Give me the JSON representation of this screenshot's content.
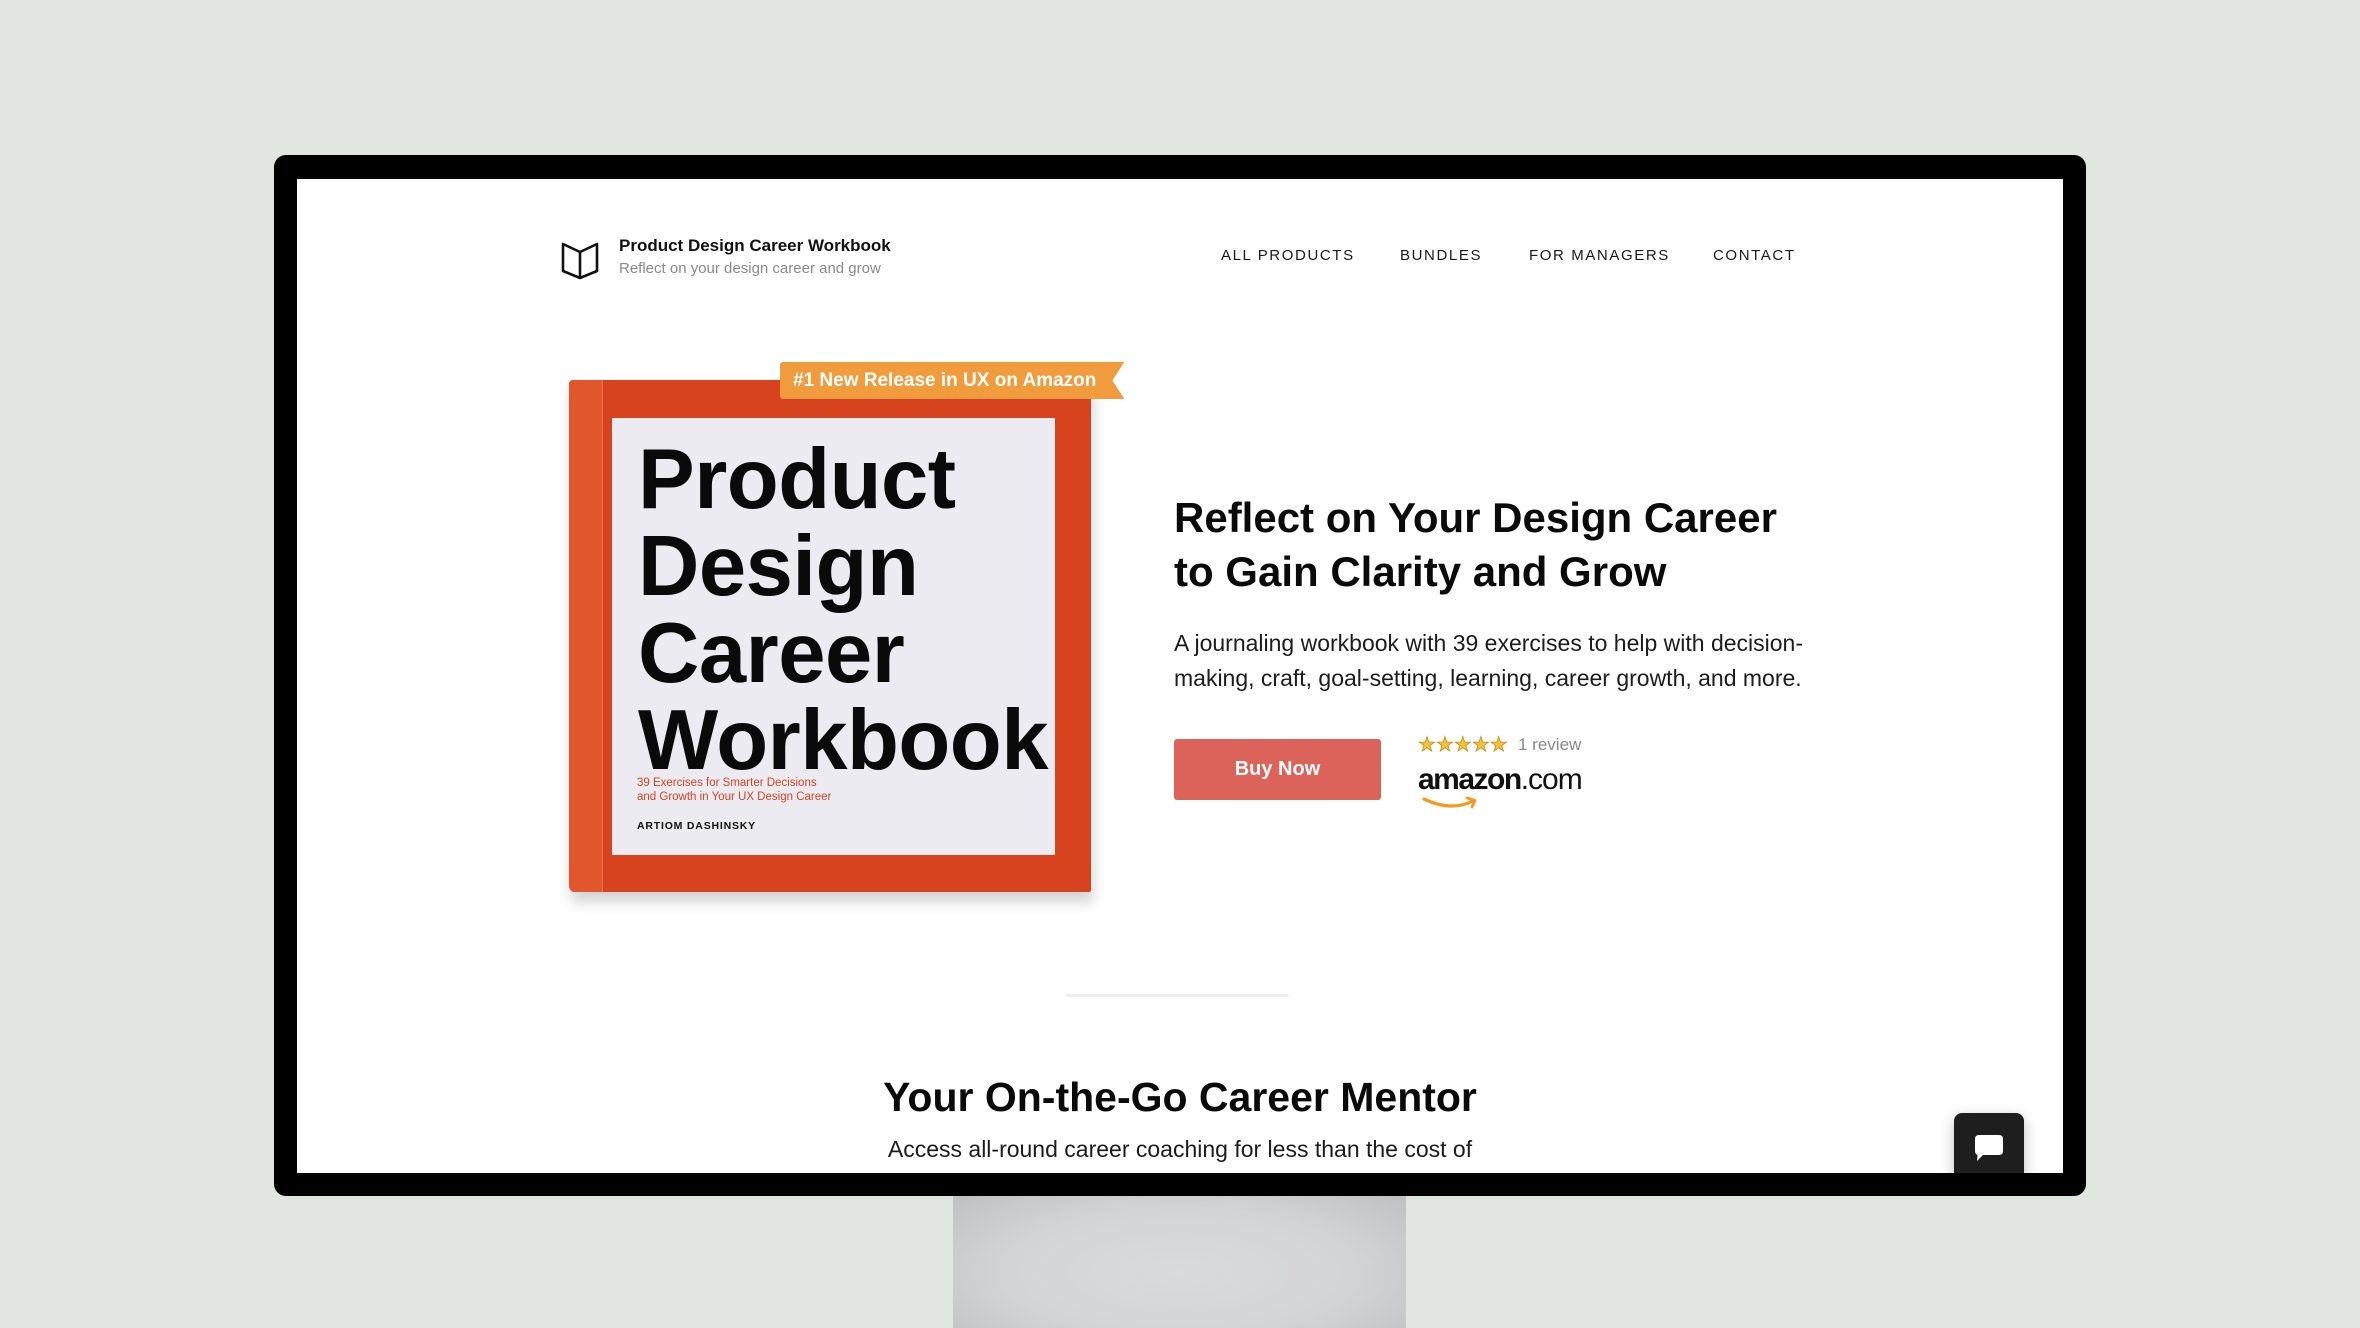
{
  "brand": {
    "icon": "open-book-icon",
    "title": "Product Design Career Workbook",
    "subtitle": "Reflect on your design career and grow"
  },
  "nav": {
    "items": [
      {
        "label": "ALL PRODUCTS"
      },
      {
        "label": "BUNDLES"
      },
      {
        "label": "FOR MANAGERS"
      },
      {
        "label": "CONTACT"
      }
    ]
  },
  "hero": {
    "badge": "#1 New Release in UX on Amazon",
    "book_cover": {
      "title_lines": [
        "Product",
        "Design",
        "Career",
        "Workbook"
      ],
      "subtitle_lines": [
        "39 Exercises for Smarter Decisions",
        "and Growth in Your UX Design Career"
      ],
      "author": "ARTIOM DASHINSKY"
    },
    "headline_lines": [
      "Reflect on Your Design Career",
      "to Gain Clarity and Grow"
    ],
    "description": "A journaling workbook with 39 exercises to help with decision-making, craft, goal-setting, learning, career growth, and more.",
    "buy_label": "Buy Now",
    "rating": {
      "stars": 5,
      "max": 5,
      "review_count": "1 review",
      "icon": "star-icon"
    },
    "retailer": {
      "name": "amazon",
      "suffix": ".com"
    }
  },
  "section": {
    "title": "Your On-the-Go Career Mentor",
    "subtitle": "Access all-round career coaching for less than the cost of"
  },
  "chat": {
    "icon": "chat-bubble-icon"
  },
  "colors": {
    "book_red": "#D8431F",
    "badge_orange": "#F09C3D",
    "buy_button": "#DB6359",
    "star_gold": "#F5C13B",
    "amazon_orange": "#F39A22"
  }
}
